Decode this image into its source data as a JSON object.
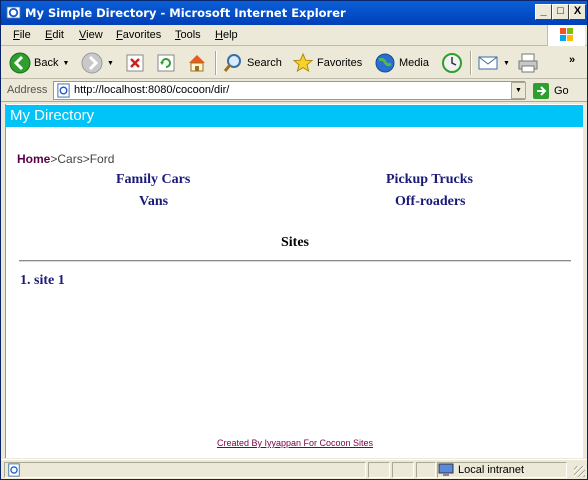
{
  "window": {
    "title": "My Simple Directory - Microsoft Internet Explorer",
    "controls": {
      "minimize": "_",
      "maximize": "□",
      "close": "X"
    }
  },
  "menu": {
    "items": [
      {
        "label": "File",
        "accel": "F",
        "rest": "ile"
      },
      {
        "label": "Edit",
        "accel": "E",
        "rest": "dit"
      },
      {
        "label": "View",
        "accel": "V",
        "rest": "iew"
      },
      {
        "label": "Favorites",
        "accel": "F",
        "rest": "avorites"
      },
      {
        "label": "Tools",
        "accel": "T",
        "rest": "ools"
      },
      {
        "label": "Help",
        "accel": "H",
        "rest": "elp"
      }
    ]
  },
  "toolbar": {
    "back_label": "Back",
    "search_label": "Search",
    "favorites_label": "Favorites",
    "media_label": "Media",
    "more": "»"
  },
  "address": {
    "label": "Address",
    "url": "http://localhost:8080/cocoon/dir/",
    "go_label": "Go"
  },
  "page": {
    "header": "My Directory",
    "breadcrumb": {
      "home": "Home",
      "rest": ">Cars>Ford"
    },
    "categories": [
      "Family Cars",
      "Pickup Trucks",
      "Vans",
      "Off-roaders"
    ],
    "sites_title": "Sites",
    "sites": [
      "1. site 1"
    ],
    "footer": "Created By Iyyappan For Cocoon Sites"
  },
  "status": {
    "zone": "Local intranet"
  },
  "colors": {
    "header_bg": "#00c3f7",
    "link": "#1a1a7a",
    "visited": "#5a004a"
  }
}
